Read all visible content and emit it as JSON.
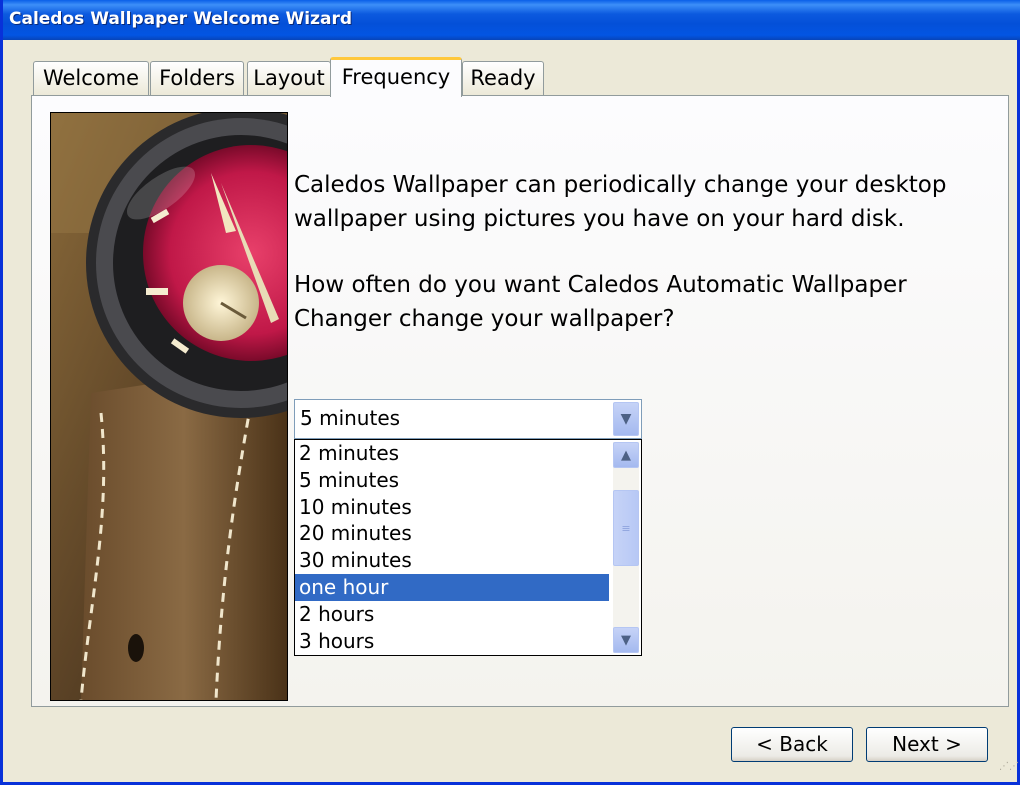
{
  "window": {
    "title": "Caledos Wallpaper Welcome Wizard"
  },
  "tabs": [
    {
      "label": "Welcome",
      "active": false
    },
    {
      "label": "Folders",
      "active": false
    },
    {
      "label": "Layout",
      "active": false
    },
    {
      "label": "Frequency",
      "active": true
    },
    {
      "label": "Ready",
      "active": false
    }
  ],
  "content": {
    "paragraph1": "Caledos Wallpaper can periodically change your desktop wallpaper using pictures you have on your hard disk.",
    "paragraph2": "How often do you want Caledos Automatic Wallpaper Changer change your wallpaper?"
  },
  "frequency_select": {
    "selected_value": "5 minutes",
    "options": [
      "2 minutes",
      "5 minutes",
      "10 minutes",
      "20 minutes",
      "30 minutes",
      "one hour",
      "2 hours",
      "3 hours"
    ],
    "highlighted_option": "one hour"
  },
  "buttons": {
    "back": "< Back",
    "next": "Next >"
  },
  "icons": {
    "combo_arrow": "chevron-down-icon",
    "scroll_up": "chevron-up-icon",
    "scroll_down": "chevron-down-icon",
    "scroll_grip": "grip-icon",
    "image": "wristwatch-photo"
  },
  "colors": {
    "title_bar": "#0450d8",
    "selection": "#316ac5",
    "active_tab_accent": "#ffc83c",
    "window_bg": "#ece9d8"
  }
}
